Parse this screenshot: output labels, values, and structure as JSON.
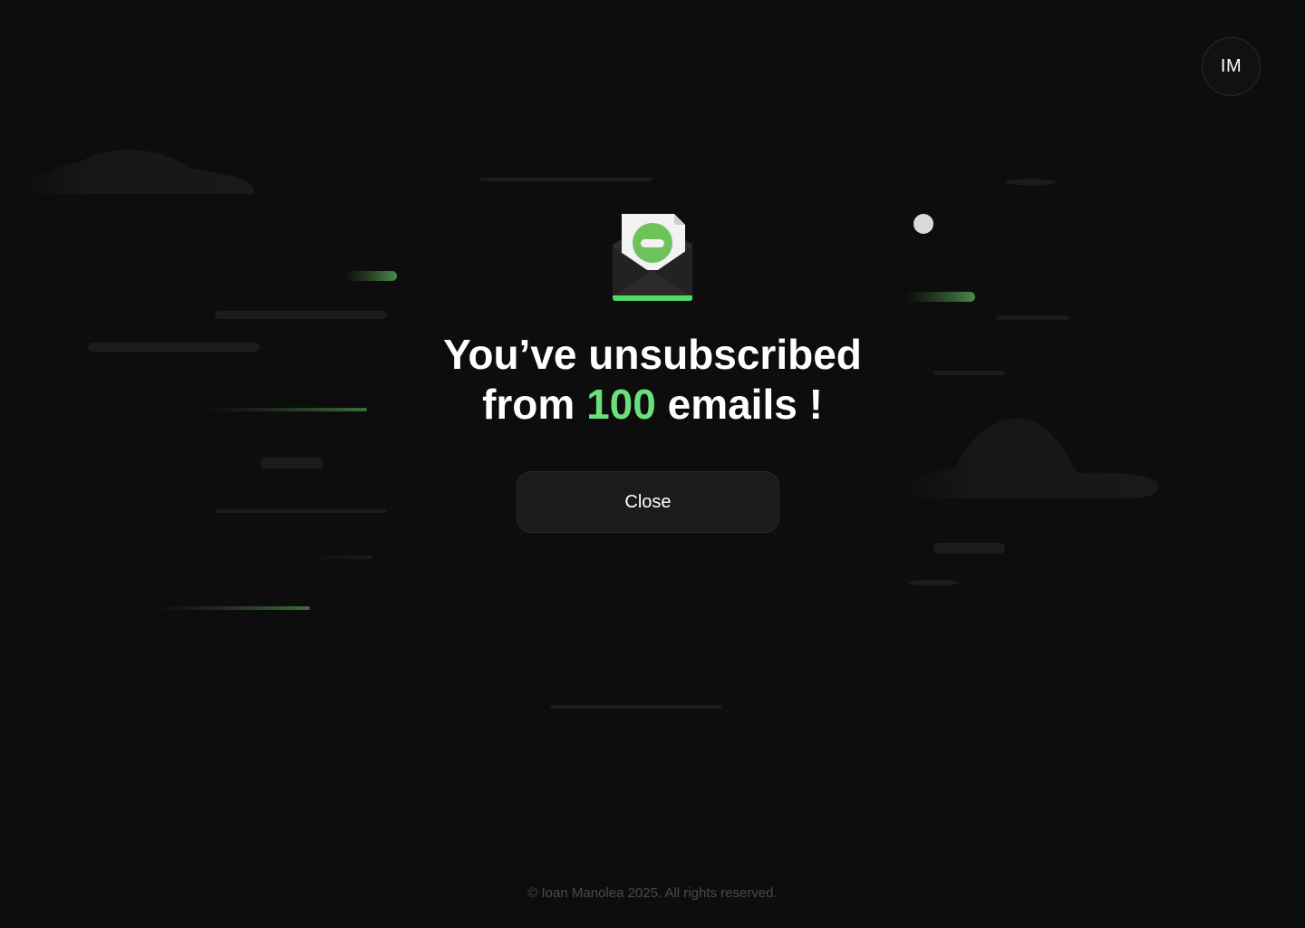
{
  "header": {
    "avatar_initials": "IM"
  },
  "main": {
    "headline_line1": "You’ve unsubscribed",
    "headline_from": "from ",
    "unsubscribed_count": "100",
    "headline_suffix": " emails !",
    "close_label": "Close",
    "icon": "envelope-unsubscribe-icon"
  },
  "footer": {
    "copyright": "© Ioan Manolea 2025. All rights reserved."
  },
  "colors": {
    "background": "#0d0d0d",
    "accent_green": "#6bdf7c",
    "button_bg": "#1b1b1b",
    "footer_text": "#4a4a4a"
  }
}
